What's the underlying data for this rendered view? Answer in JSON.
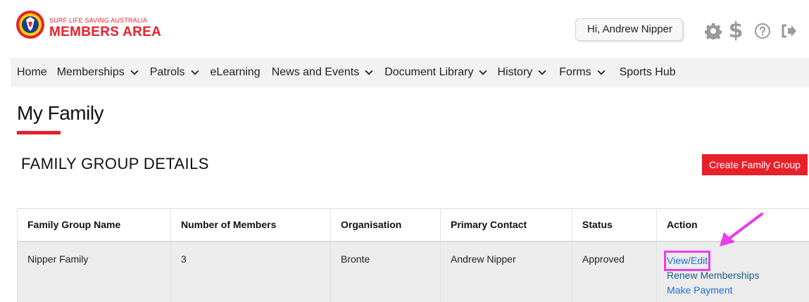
{
  "brand": {
    "small": "SURF LIFE SAVING AUSTRALIA",
    "big": "MEMBERS AREA",
    "logo_icon": "surf-life-saving-logo"
  },
  "header": {
    "greeting": "Hi, Andrew Nipper",
    "icons": [
      "gear-icon",
      "dollar-icon",
      "help-icon",
      "logout-icon"
    ]
  },
  "nav": {
    "items": [
      {
        "label": "Home",
        "dropdown": false
      },
      {
        "label": "Memberships",
        "dropdown": true
      },
      {
        "label": "Patrols",
        "dropdown": true
      },
      {
        "label": "eLearning",
        "dropdown": false
      },
      {
        "label": "News and Events",
        "dropdown": true
      },
      {
        "label": "Document Library",
        "dropdown": true
      },
      {
        "label": "History",
        "dropdown": true
      },
      {
        "label": "Forms",
        "dropdown": true
      },
      {
        "label": "Sports Hub",
        "dropdown": false
      }
    ]
  },
  "page": {
    "title": "My Family",
    "section_title": "FAMILY GROUP DETAILS",
    "create_button": "Create Family Group"
  },
  "table": {
    "headers": [
      "Family Group Name",
      "Number of Members",
      "Organisation",
      "Primary Contact",
      "Status",
      "Action"
    ],
    "rows": [
      {
        "name": "Nipper Family",
        "members": "3",
        "organisation": "Bronte",
        "contact": "Andrew Nipper",
        "status": "Approved",
        "actions": [
          "View/Edit",
          "Renew Memberships",
          "Make Payment"
        ]
      }
    ]
  },
  "colors": {
    "brand_red": "#e8202a",
    "link_blue": "#1f6fd6",
    "highlight_magenta": "#e83df0",
    "nav_bg": "#f2f2f3",
    "row_bg": "#ececec"
  }
}
